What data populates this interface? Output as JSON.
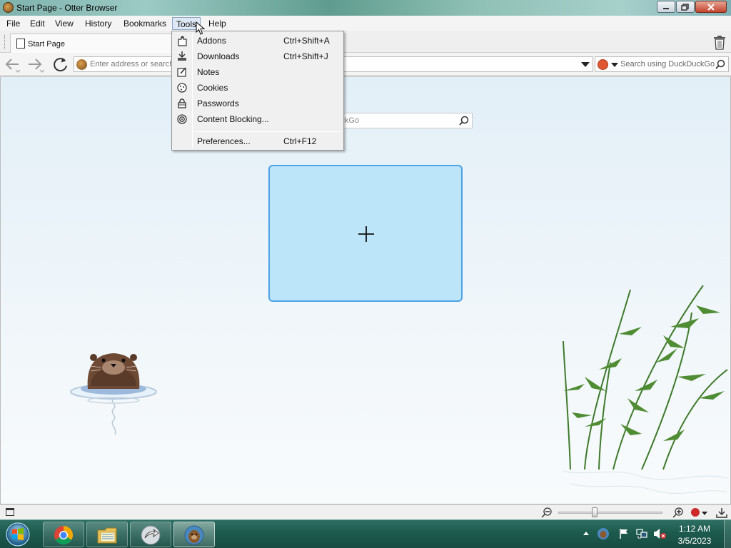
{
  "window": {
    "title": "Start Page - Otter Browser"
  },
  "menubar": {
    "items": [
      "File",
      "Edit",
      "View",
      "History",
      "Bookmarks",
      "Tools",
      "Help"
    ],
    "active": "Tools"
  },
  "tabs": [
    {
      "label": "Start Page"
    }
  ],
  "navbar": {
    "address_placeholder": "Enter address or search...",
    "search_placeholder": "Search using DuckDuckGo"
  },
  "start_page": {
    "search_placeholder": "Search using DuckDuckGo"
  },
  "tools_menu": {
    "items": [
      {
        "label": "Addons",
        "shortcut": "Ctrl+Shift+A",
        "icon": "addons-icon"
      },
      {
        "label": "Downloads",
        "shortcut": "Ctrl+Shift+J",
        "icon": "downloads-icon"
      },
      {
        "label": "Notes",
        "shortcut": "",
        "icon": "notes-icon"
      },
      {
        "label": "Cookies",
        "shortcut": "",
        "icon": "cookies-icon"
      },
      {
        "label": "Passwords",
        "shortcut": "",
        "icon": "lock-icon"
      },
      {
        "label": "Content Blocking...",
        "shortcut": "",
        "icon": "content-blocking-icon"
      },
      {
        "label": "Preferences...",
        "shortcut": "Ctrl+F12",
        "icon": ""
      }
    ]
  },
  "taskbar": {
    "clock_time": "1:12 AM",
    "clock_date": "3/5/2023",
    "apps": [
      "chrome-icon",
      "file-explorer-icon",
      "app-arrow-icon",
      "otter-browser-icon"
    ]
  },
  "colors": {
    "speed_dial_fill": "#bde5fa",
    "speed_dial_border": "#4da3e6",
    "menu_highlight": "#dde8f4"
  }
}
